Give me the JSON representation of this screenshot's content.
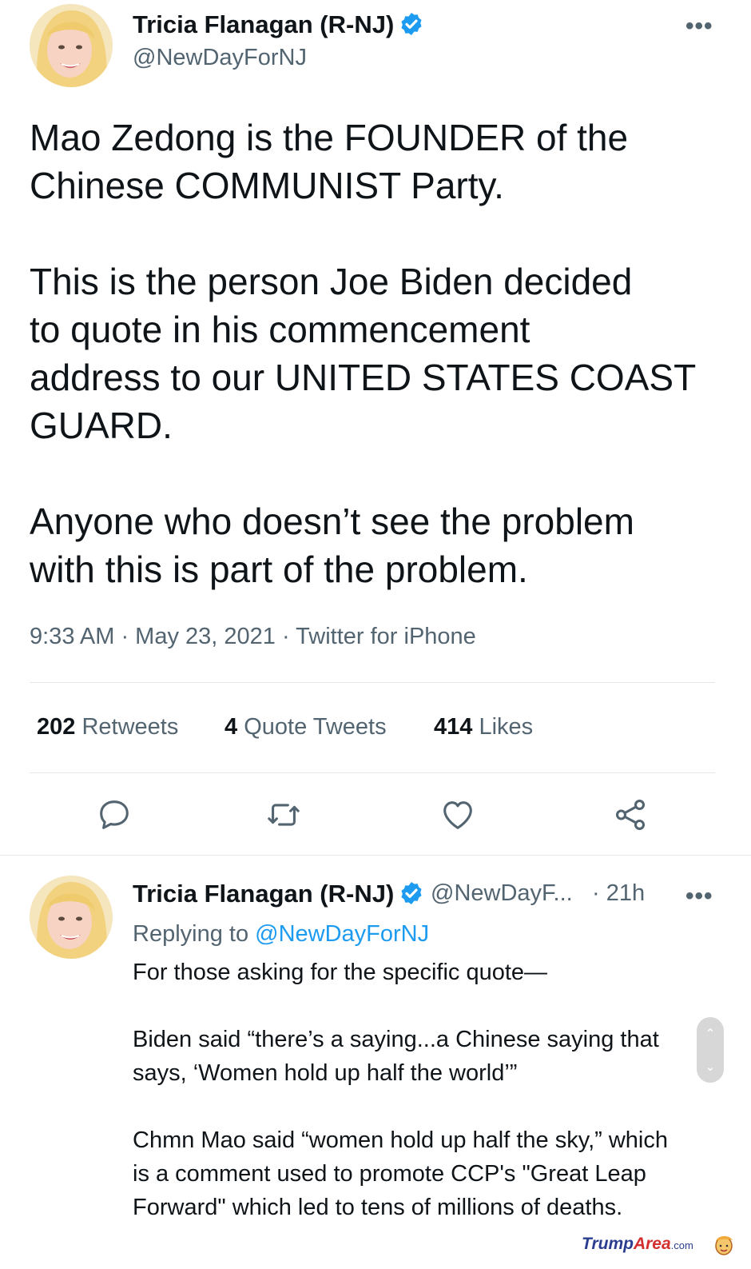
{
  "main_tweet": {
    "author_name": "Tricia Flanagan (R-NJ)",
    "handle": "@NewDayForNJ",
    "more_label": "•••",
    "paragraphs": [
      [
        "Mao Zedong is the FOUNDER of the",
        "Chinese COMMUNIST Party."
      ],
      [
        "This is the person Joe Biden decided",
        "to quote in his commencement",
        "address to our UNITED STATES COAST",
        "GUARD."
      ],
      [
        "Anyone who doesn’t see the problem",
        "with this is part of the problem."
      ]
    ],
    "timestamp": "9:33 AM · May 23, 2021 · Twitter for iPhone",
    "stats": {
      "retweets_count": "202",
      "retweets_label": "Retweets",
      "quotes_count": "4",
      "quotes_label": "Quote Tweets",
      "likes_count": "414",
      "likes_label": "Likes"
    },
    "actions": [
      "reply-icon",
      "retweet-icon",
      "like-icon",
      "share-icon"
    ]
  },
  "reply_tweet": {
    "author_name": "Tricia Flanagan (R-NJ)",
    "handle": "@NewDayF...",
    "time": "· 21h",
    "more_label": "•••",
    "replying_prefix": "Replying to",
    "replying_handle": "@NewDayForNJ",
    "lines": [
      "For those asking for the specific quote—",
      "",
      "Biden said “there’s a saying...a Chinese saying that",
      "says, ‘Women hold up half the world’”",
      "",
      "Chmn Mao said “women hold up half the sky,” which",
      "is a comment used to promote CCP's \"Great Leap",
      "Forward\" which led to tens of millions of deaths."
    ]
  },
  "watermark": {
    "brand_a": "Trump",
    "brand_b": "Area",
    "suffix": ".com"
  },
  "colors": {
    "verified": "#1d9bf0",
    "secondary_text": "#536471",
    "link": "#1d9bf0"
  }
}
